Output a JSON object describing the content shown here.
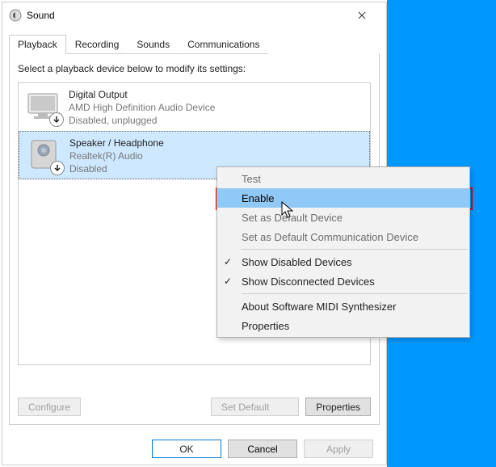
{
  "window": {
    "title": "Sound",
    "tabs": {
      "t0": "Playback",
      "t1": "Recording",
      "t2": "Sounds",
      "t3": "Communications"
    },
    "instruction": "Select a playback device below to modify its settings:",
    "buttons": {
      "configure": "Configure",
      "setdefault": "Set Default",
      "properties": "Properties",
      "ok": "OK",
      "cancel": "Cancel",
      "apply": "Apply"
    }
  },
  "devices": {
    "d0": {
      "name": "Digital Output",
      "sub1": "AMD High Definition Audio Device",
      "sub2": "Disabled, unplugged"
    },
    "d1": {
      "name": "Speaker / Headphone",
      "sub1": "Realtek(R) Audio",
      "sub2": "Disabled"
    }
  },
  "context_menu": {
    "test": "Test",
    "enable": "Enable",
    "set_default": "Set as Default Device",
    "set_default_comm": "Set as Default Communication Device",
    "show_disabled": "Show Disabled Devices",
    "show_disconnected": "Show Disconnected Devices",
    "about_midi": "About Software MIDI Synthesizer",
    "properties": "Properties"
  }
}
